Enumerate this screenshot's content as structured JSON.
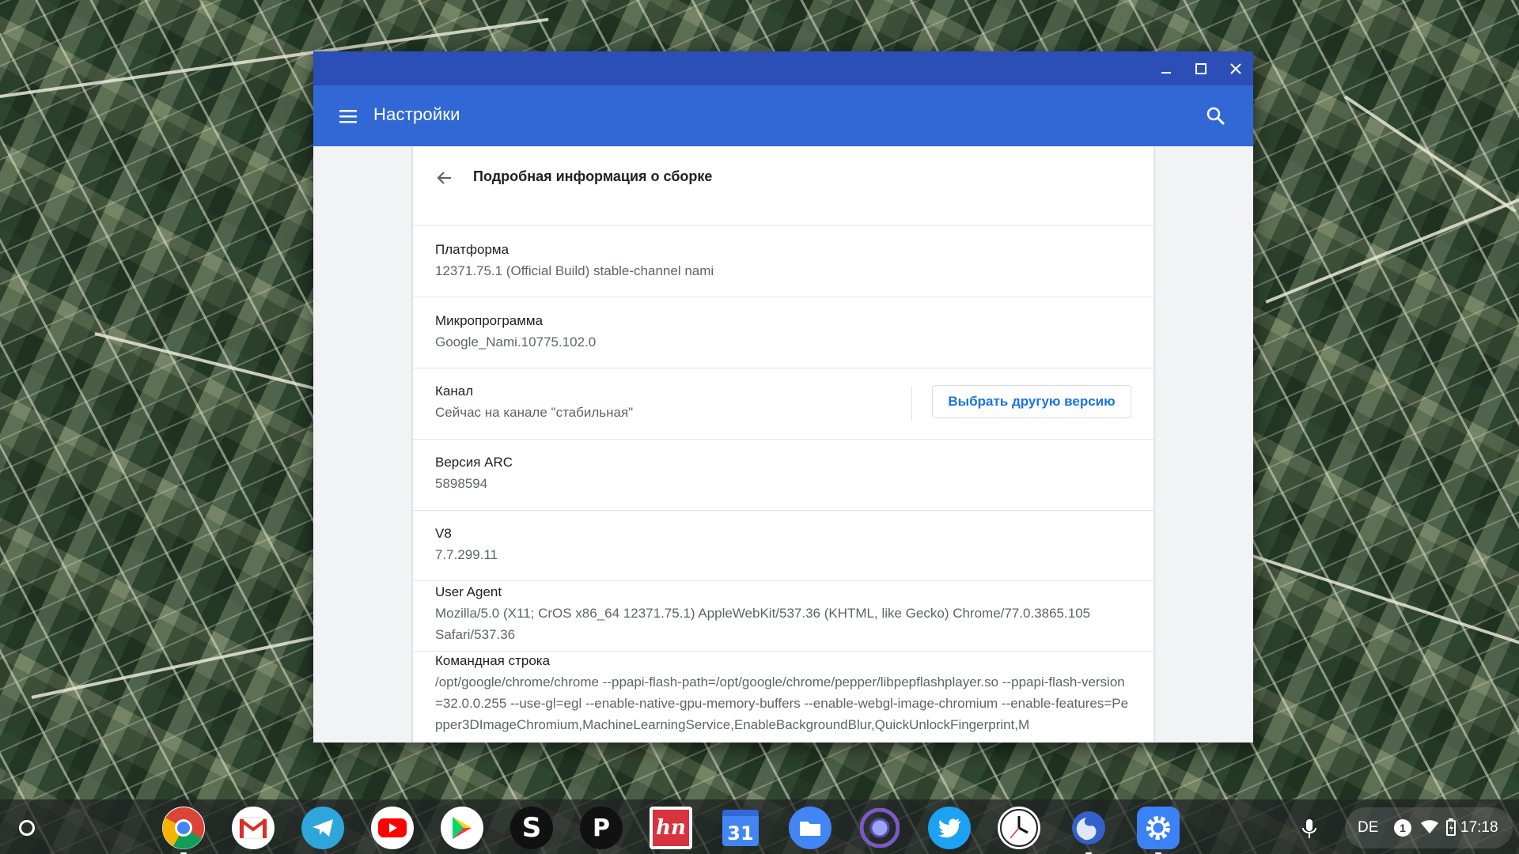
{
  "window": {
    "title": "Настройки",
    "controls": [
      "minimize-icon",
      "maximize-icon",
      "close-icon"
    ]
  },
  "toolbar": {
    "menu_icon": "hamburger-icon",
    "search_icon": "search-icon"
  },
  "page": {
    "back_icon": "arrow-back-icon",
    "title": "Подробная информация о сборке",
    "rows": {
      "platform": {
        "label": "Платформа",
        "value": "12371.75.1 (Official Build) stable-channel nami"
      },
      "firmware": {
        "label": "Микропрограмма",
        "value": "Google_Nami.10775.102.0"
      },
      "channel": {
        "label": "Канал",
        "value": "Сейчас на канале \"стабильная\"",
        "button": "Выбрать другую версию"
      },
      "arc": {
        "label": "Версия ARC",
        "value": "5898594"
      },
      "v8": {
        "label": "V8",
        "value": "7.7.299.11"
      },
      "user_agent": {
        "label": "User Agent",
        "value": "Mozilla/5.0 (X11; CrOS x86_64 12371.75.1) AppleWebKit/537.36 (KHTML, like Gecko) Chrome/77.0.3865.105 Safari/537.36"
      },
      "command_line": {
        "label": "Командная строка",
        "value": "/opt/google/chrome/chrome --ppapi-flash-path=/opt/google/chrome/pepper/libpepflashplayer.so --ppapi-flash-version=32.0.0.255 --use-gl=egl --enable-native-gpu-memory-buffers --enable-webgl-image-chromium --enable-features=Pepper3DImageChromium,MachineLearningService,EnableBackgroundBlur,QuickUnlockFingerprint,M"
      }
    }
  },
  "shelf": {
    "launcher_icon": "launcher-icon",
    "apps": [
      {
        "name": "chrome-icon"
      },
      {
        "name": "gmail-icon"
      },
      {
        "name": "telegram-icon"
      },
      {
        "name": "youtube-icon"
      },
      {
        "name": "play-store-icon"
      },
      {
        "name": "slack-icon",
        "glyph": "S"
      },
      {
        "name": "pocket-casts-icon",
        "glyph": "P"
      },
      {
        "name": "hn-icon",
        "glyph": "hn"
      },
      {
        "name": "calendar-icon",
        "glyph": "31"
      },
      {
        "name": "files-icon"
      },
      {
        "name": "chromium-icon"
      },
      {
        "name": "twitter-icon"
      },
      {
        "name": "clock-icon"
      },
      {
        "name": "simplenote-icon"
      },
      {
        "name": "settings-icon"
      }
    ],
    "mic_icon": "microphone-icon",
    "tray": {
      "ime": "DE",
      "notification_count": "1",
      "wifi_icon": "wifi-icon",
      "battery_icon": "battery-icon",
      "time": "17:18"
    }
  },
  "colors": {
    "titlebar": "#2b4fb6",
    "toolbar": "#3168d6",
    "accent": "#1a73e8"
  }
}
